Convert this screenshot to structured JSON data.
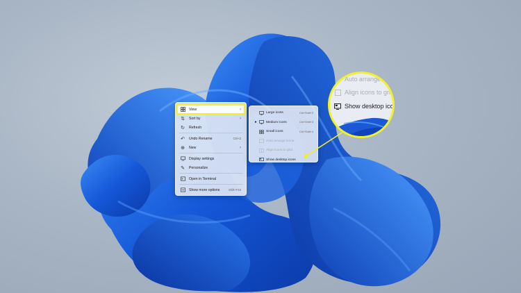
{
  "context_menu": {
    "items": [
      {
        "label": "View",
        "icon": "grid-icon",
        "shortcut": "",
        "submenu": true
      },
      {
        "label": "Sort by",
        "icon": "sort-icon",
        "shortcut": "",
        "submenu": true
      },
      {
        "label": "Refresh",
        "icon": "refresh-icon",
        "shortcut": "",
        "submenu": false
      },
      {
        "label": "Undo Rename",
        "icon": "undo-icon",
        "shortcut": "Ctrl+Z",
        "submenu": false
      },
      {
        "label": "New",
        "icon": "plus-icon",
        "shortcut": "",
        "submenu": true
      },
      {
        "label": "Display settings",
        "icon": "display-icon",
        "shortcut": "",
        "submenu": false
      },
      {
        "label": "Personalize",
        "icon": "brush-icon",
        "shortcut": "",
        "submenu": false
      },
      {
        "label": "Open in Terminal",
        "icon": "terminal-icon",
        "shortcut": "",
        "submenu": false
      },
      {
        "label": "Show more options",
        "icon": "more-options-icon",
        "shortcut": "Shift+F10",
        "submenu": false
      }
    ]
  },
  "view_submenu": {
    "items": [
      {
        "label": "Large icons",
        "shortcut": "Ctrl+Shift+2",
        "checked": false,
        "disabled": false
      },
      {
        "label": "Medium icons",
        "shortcut": "Ctrl+Shift+3",
        "checked": true,
        "disabled": false
      },
      {
        "label": "Small icons",
        "shortcut": "Ctrl+Shift+4",
        "checked": false,
        "disabled": false
      },
      {
        "label": "Auto arrange icons",
        "shortcut": "",
        "checked": false,
        "disabled": true
      },
      {
        "label": "Align icons to grid",
        "shortcut": "",
        "checked": false,
        "disabled": true
      },
      {
        "label": "Show desktop icons",
        "shortcut": "",
        "checked": false,
        "disabled": false
      }
    ]
  },
  "zoom_callout": {
    "items": [
      "Auto arrange i",
      "Align icons to grid",
      "Show desktop icons"
    ]
  },
  "colors": {
    "highlight": "#f3ef2b",
    "bloom_blue": "#1f5fd6",
    "background": "#a9b6c5"
  }
}
